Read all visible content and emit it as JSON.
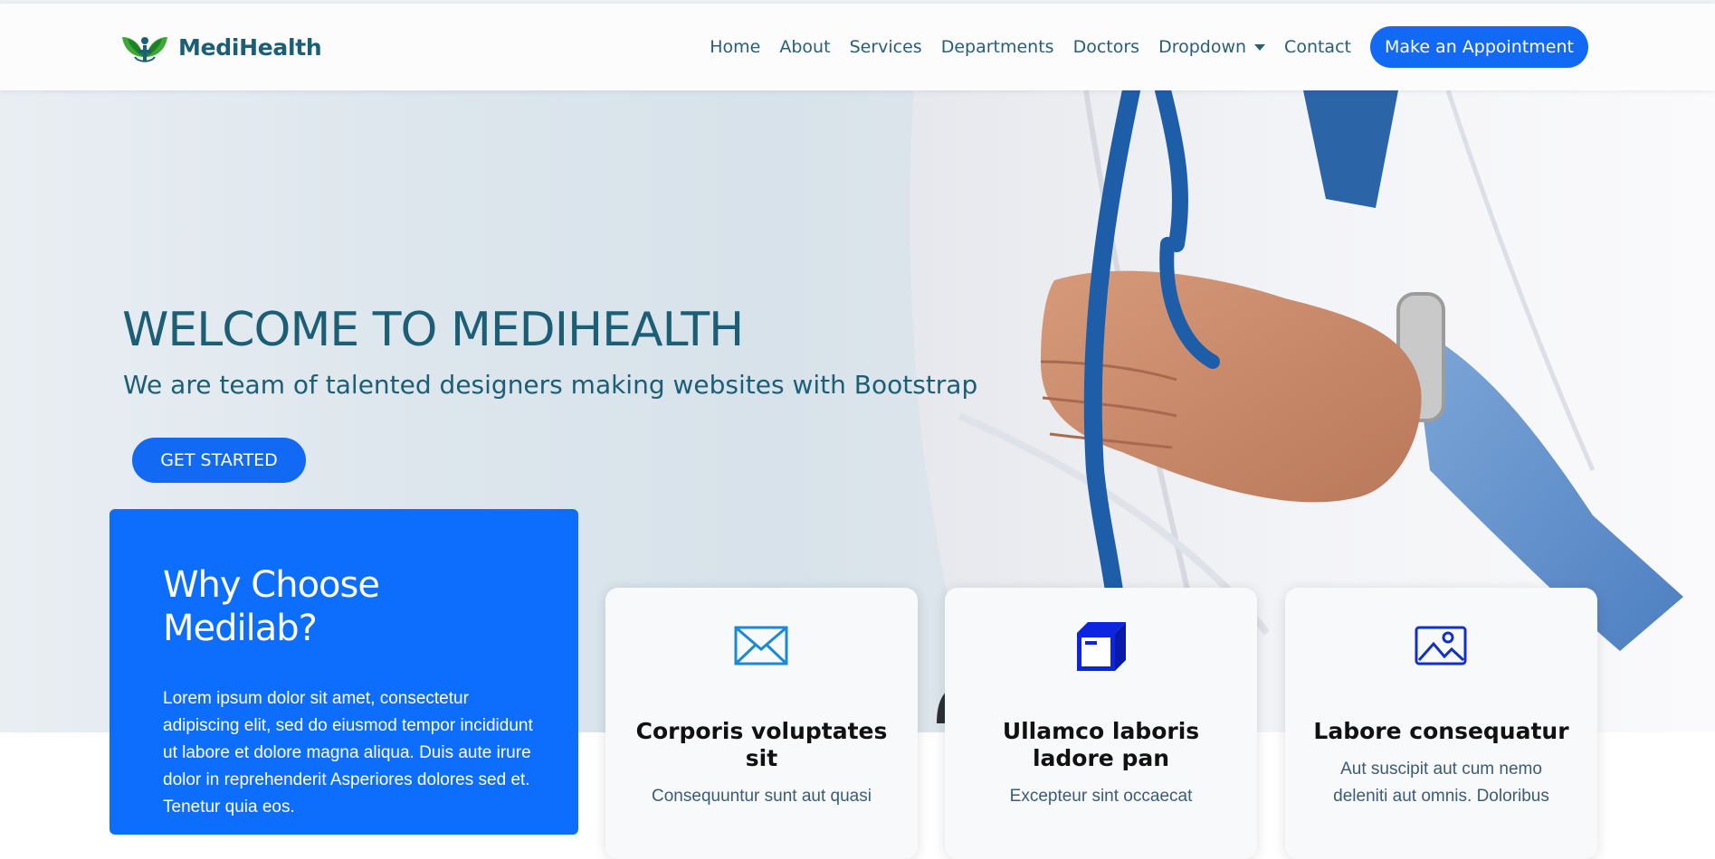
{
  "brand": {
    "name": "MediHealth"
  },
  "nav": {
    "items": [
      {
        "label": "Home"
      },
      {
        "label": "About"
      },
      {
        "label": "Services"
      },
      {
        "label": "Departments"
      },
      {
        "label": "Doctors"
      },
      {
        "label": "Dropdown"
      },
      {
        "label": "Contact"
      }
    ],
    "cta": "Make an Appointment"
  },
  "hero": {
    "title": "WELCOME TO MEDIHEALTH",
    "subtitle": "We are team of talented designers making websites with Bootstrap",
    "button": "GET STARTED"
  },
  "why": {
    "title_line1": "Why Choose",
    "title_line2": "Medilab?",
    "text": "Lorem ipsum dolor sit amet, consectetur adipiscing elit, sed do eiusmod tempor incididunt ut labore et dolore magna aliqua. Duis aute irure dolor in reprehenderit Asperiores dolores sed et. Tenetur quia eos."
  },
  "cards": [
    {
      "icon": "envelope-icon",
      "title_line1": "Corporis voluptates",
      "title_line2": "sit",
      "text": "Consequuntur sunt aut quasi"
    },
    {
      "icon": "box-icon",
      "title_line1": "Ullamco laboris",
      "title_line2": "ladore pan",
      "text": "Excepteur sint occaecat"
    },
    {
      "icon": "image-icon",
      "title_line1": "Labore consequatur",
      "title_line2": "",
      "text": "Aut suscipit aut cum nemo deleniti aut omnis. Doloribus"
    }
  ],
  "colors": {
    "primary": "#1269f3",
    "heading": "#1b5e75",
    "nav_text": "#2a5d79",
    "why_card": "#0d6efd",
    "box_icon": "#0d24e0"
  }
}
